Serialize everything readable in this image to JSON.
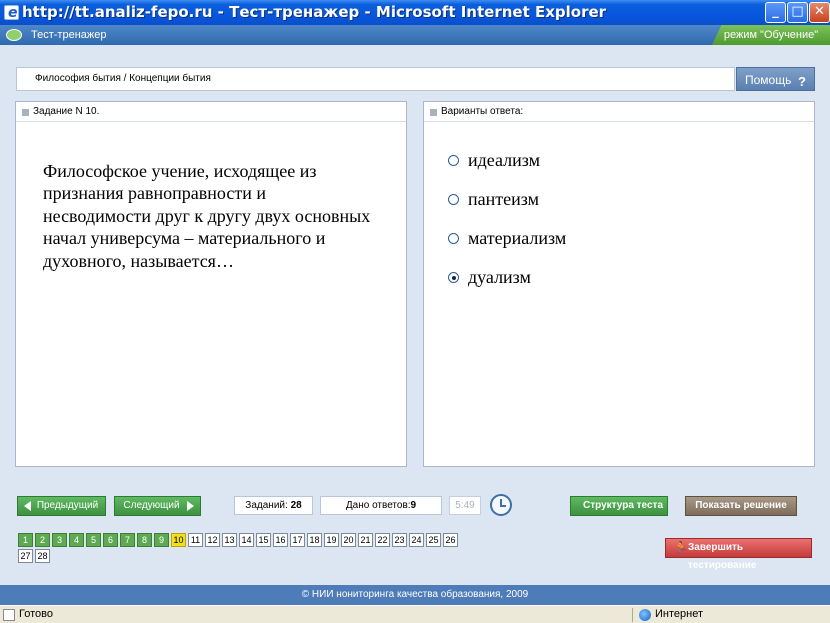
{
  "window": {
    "title": "http://tt.analiz-fepo.ru - Тест-тренажер - Microsoft Internet Explorer",
    "minimize": "_",
    "maximize": "□",
    "close": "✕"
  },
  "appbar": {
    "title": "Тест-тренажер",
    "mode": "режим \"Обучение\""
  },
  "breadcrumb": "Философия бытия / Концепции бытия",
  "help": {
    "label": "Помощь",
    "icon": "?"
  },
  "task": {
    "header": "Задание N 10.",
    "text": "Философское учение, исходящее из признания равноправности и несводимости друг к другу двух основных начал универсума – материального и духовного, называется…"
  },
  "answers": {
    "header": "Варианты ответа:",
    "options": [
      {
        "label": "идеализм",
        "selected": false
      },
      {
        "label": "пантеизм",
        "selected": false
      },
      {
        "label": "материализм",
        "selected": false
      },
      {
        "label": "дуализм",
        "selected": true
      }
    ]
  },
  "nav": {
    "prev": "Предыдущий",
    "next": "Следующий",
    "tasks_label": "Заданий:",
    "tasks_count": "28",
    "answered_label": "Дано ответов:",
    "answered_count": "9",
    "timer": "5:49",
    "structure": "Структура теста",
    "show_solution": "Показать решение",
    "finish": "Завершить тестирование"
  },
  "task_grid": {
    "items": [
      "1",
      "2",
      "3",
      "4",
      "5",
      "6",
      "7",
      "8",
      "9",
      "10",
      "11",
      "12",
      "13",
      "14",
      "15",
      "16",
      "17",
      "18",
      "19",
      "20",
      "21",
      "22",
      "23",
      "24",
      "25",
      "26",
      "27",
      "28"
    ],
    "answered_count": 9,
    "current_index": 9
  },
  "footer": "© НИИ нониторинга качества образования, 2009",
  "status": {
    "left": "Готово",
    "zone": "Интернет"
  },
  "colors": {
    "answered_cell": "#5eaa52",
    "current_cell": "#f4e01a",
    "title_bar": "#0855dd"
  }
}
